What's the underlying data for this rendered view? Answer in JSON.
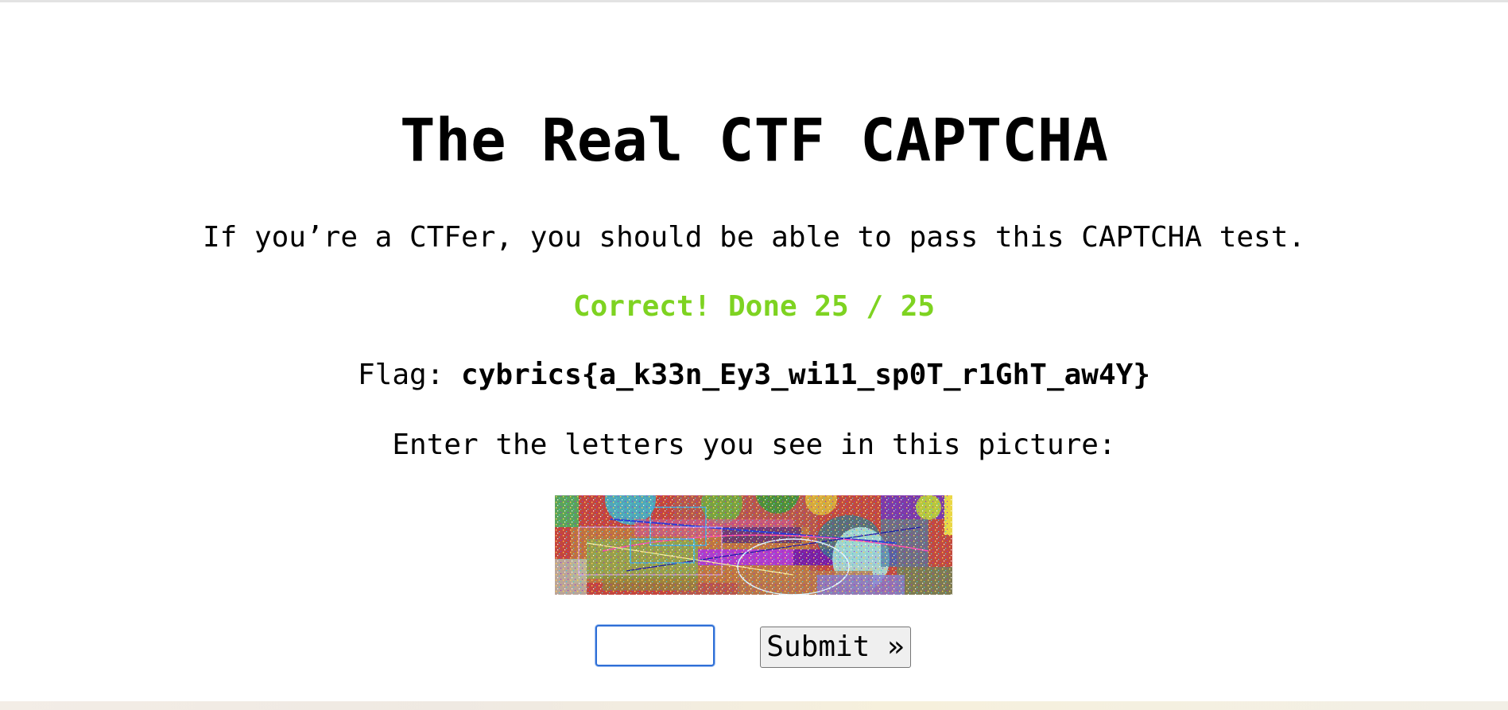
{
  "page": {
    "title": "The Real CTF CAPTCHA",
    "subtitle": "If you’re a CTFer, you should be able to pass this CAPTCHA test.",
    "status": "Correct! Done 25 / 25",
    "flag_label": "Flag: ",
    "flag_value": "cybrics{a_k33n_Ey3_wi11_sp0T_r1GhT_aw4Y}",
    "prompt": "Enter the letters you see in this picture:"
  },
  "form": {
    "answer_value": "",
    "submit_label": "Submit »"
  },
  "colors": {
    "status_green": "#7ed321",
    "input_focus": "#2f6fd6"
  }
}
